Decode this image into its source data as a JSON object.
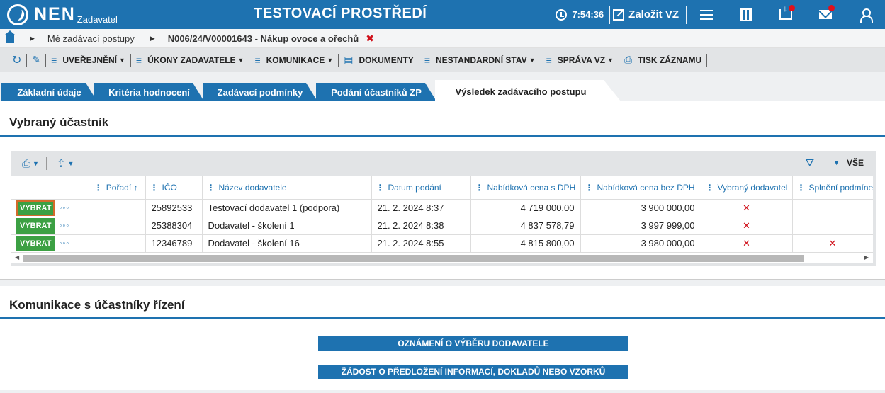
{
  "topbar": {
    "logo_text": "NEN",
    "logo_sub": "Zadavatel",
    "env_title": "TESTOVACÍ PROSTŘEDÍ",
    "time": "7:54:36",
    "create_label": "Založit VZ",
    "icons": [
      "clock-icon",
      "edit-icon",
      "menu-icon",
      "calculator-icon",
      "inbox-icon",
      "mail-icon",
      "user-icon"
    ],
    "notification_color": "#e0101a"
  },
  "breadcrumb": {
    "items": [
      "Mé zadávací postupy",
      "N006/24/V00001643 - Nákup ovoce a ořechů"
    ],
    "close": "✖"
  },
  "toolbar": {
    "items": [
      {
        "label": "UVEŘEJNĚNÍ",
        "dropdown": true
      },
      {
        "label": "ÚKONY ZADAVATELE",
        "dropdown": true
      },
      {
        "label": "KOMUNIKACE",
        "dropdown": true
      },
      {
        "label": "DOKUMENTY",
        "dropdown": false
      },
      {
        "label": "NESTANDARDNÍ STAV",
        "dropdown": true
      },
      {
        "label": "SPRÁVA VZ",
        "dropdown": true
      },
      {
        "label": "TISK ZÁZNAMU",
        "dropdown": false
      }
    ]
  },
  "tabs": [
    {
      "label": "Základní údaje",
      "active": false
    },
    {
      "label": "Kritéria hodnocení",
      "active": false
    },
    {
      "label": "Zadávací podmínky",
      "active": false
    },
    {
      "label": "Podání účastníků ZP",
      "active": false
    },
    {
      "label": "Výsledek zadávacího postupu",
      "active": true
    }
  ],
  "selected_section": {
    "title": "Vybraný účastník",
    "grid_right_label": "VŠE",
    "columns": [
      "Pořadí ↑",
      "IČO",
      "Název dodavatele",
      "Datum podání",
      "Nabídková cena s DPH",
      "Nabídková cena bez DPH",
      "Vybraný dodavatel",
      "Splnění podmínek"
    ],
    "rows": [
      {
        "action": "VYBRAT",
        "ico": "25892533",
        "name": "Testovací dodavatel 1 (podpora)",
        "date": "21. 2. 2024 8:37",
        "price_vat": "4 719 000,00",
        "price_novat": "3 900 000,00",
        "selected": "✕",
        "conditions": ""
      },
      {
        "action": "VYBRAT",
        "ico": "25388304",
        "name": "Dodavatel - školení 1",
        "date": "21. 2. 2024 8:38",
        "price_vat": "4 837 578,79",
        "price_novat": "3 997 999,00",
        "selected": "✕",
        "conditions": ""
      },
      {
        "action": "VYBRAT",
        "ico": "12346789",
        "name": "Dodavatel - školení 16",
        "date": "21. 2. 2024 8:55",
        "price_vat": "4 815 800,00",
        "price_novat": "3 980 000,00",
        "selected": "✕",
        "conditions": "✕"
      }
    ]
  },
  "communication_section": {
    "title": "Komunikace s účastníky řízení",
    "buttons": [
      "OZNÁMENÍ O VÝBĚRU DODAVATELE",
      "ŽÁDOST O PŘEDLOŽENÍ INFORMACÍ, DOKLADŮ NEBO VZORKŮ"
    ]
  },
  "colors": {
    "primary": "#1e72b0",
    "action_green": "#3ca043",
    "error_red": "#d0101a"
  }
}
